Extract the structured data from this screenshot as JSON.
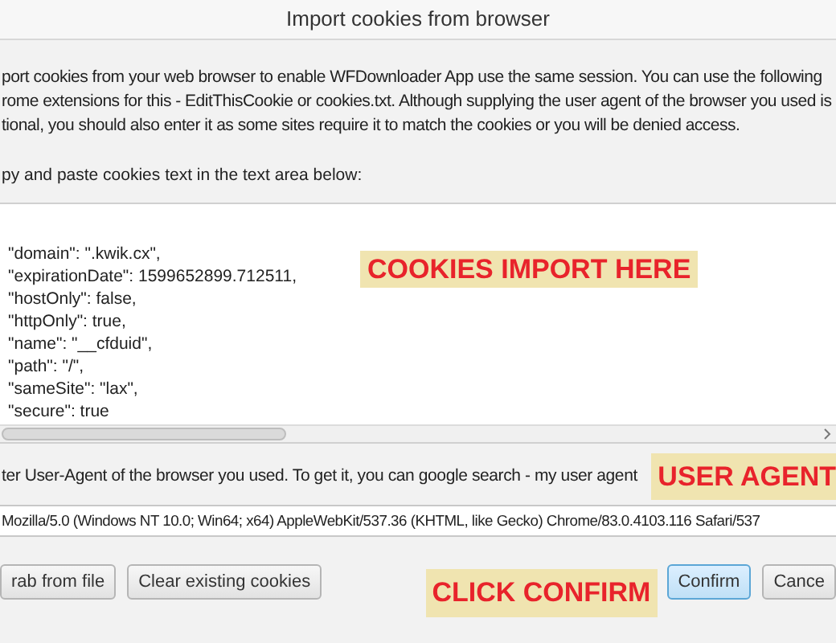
{
  "window": {
    "title": "Import cookies from browser"
  },
  "intro_lines": [
    "port cookies from your web browser to enable WFDownloader App use the same session. You can use the following",
    "rome extensions for this - EditThisCookie or cookies.txt. Although supplying the user agent of the browser you used is",
    "tional, you should also enter it as some sites require it to match the cookies or you will be denied access."
  ],
  "paste_label": "py and paste cookies text in the text area below:",
  "cookies_text": [
    "\"domain\": \".kwik.cx\",",
    "\"expirationDate\": 1599652899.712511,",
    "\"hostOnly\": false,",
    "\"httpOnly\": true,",
    "\"name\": \"__cfduid\",",
    "\"path\": \"/\",",
    "\"sameSite\": \"lax\",",
    "\"secure\": true"
  ],
  "annotations": [
    "COOKIES IMPORT HERE",
    "USER AGENT",
    "CLICK CONFIRM"
  ],
  "user_agent_label": "ter User-Agent of the browser you used. To get it, you can google search - my user agent",
  "user_agent_value": "Mozilla/5.0 (Windows NT 10.0; Win64; x64) AppleWebKit/537.36 (KHTML, like Gecko) Chrome/83.0.4103.116 Safari/537",
  "buttons": [
    {
      "label": "rab from file",
      "default": false
    },
    {
      "label": "Clear existing cookies",
      "default": false
    },
    {
      "label": "Confirm",
      "default": true
    },
    {
      "label": "Cance",
      "default": false
    }
  ]
}
